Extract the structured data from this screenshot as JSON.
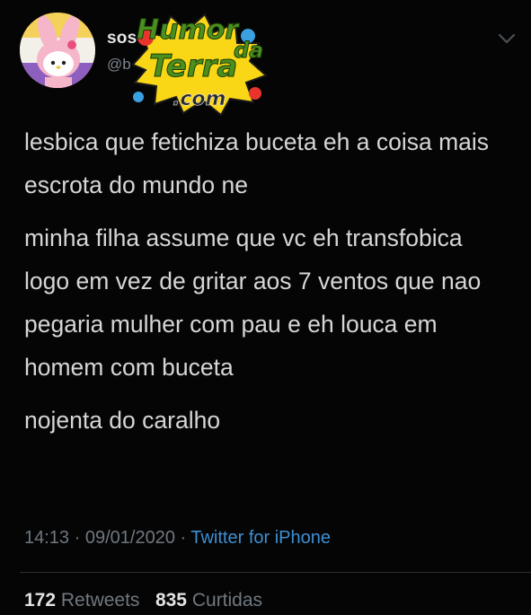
{
  "user": {
    "name": "sos",
    "handle": "@b"
  },
  "watermark": {
    "line1": "Humor",
    "line2": "da",
    "line3": "Terra",
    "line4": ".com"
  },
  "tweet": {
    "paragraphs": [
      "lesbica que fetichiza buceta eh a coisa mais escrota do mundo ne",
      "minha filha assume que vc eh transfobica logo em vez de gritar aos 7 ventos que nao pegaria mulher com pau e eh louca em homem com buceta",
      "nojenta do caralho"
    ]
  },
  "meta": {
    "time": "14:13",
    "separator": " · ",
    "date": "09/01/2020",
    "source": "Twitter for iPhone"
  },
  "stats": {
    "retweets_count": "172",
    "retweets_label": "Retweets",
    "likes_count": "835",
    "likes_label": "Curtidas"
  },
  "icons": {
    "avatar": "my-melody-avatar",
    "menu": "chevron-down-icon"
  },
  "colors": {
    "background": "#050505",
    "text": "#d6d6d6",
    "muted": "#6f7880",
    "link": "#3d8fd4"
  }
}
